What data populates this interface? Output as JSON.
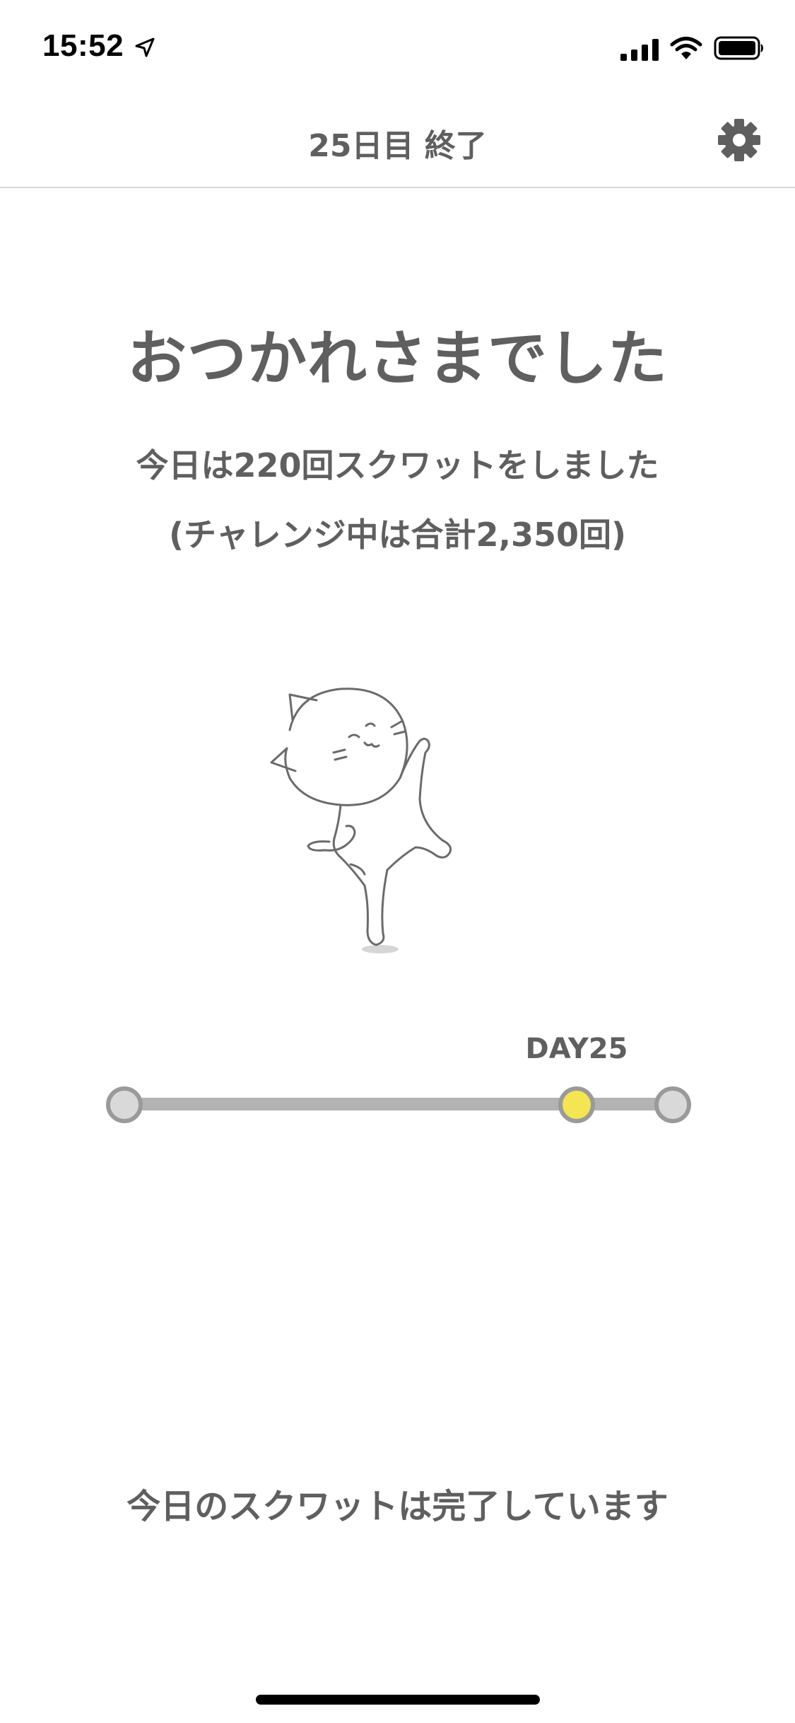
{
  "status_bar": {
    "time": "15:52",
    "icons": [
      "location-arrow-icon",
      "signal-icon",
      "wifi-icon",
      "battery-icon"
    ]
  },
  "nav": {
    "title": "25日目 終了",
    "settings_icon": "gear-icon"
  },
  "main": {
    "heading": "おつかれさまでした",
    "summary_line1": "今日は220回スクワットをしました",
    "summary_line2": "(チャレンジ中は合計2,350回)",
    "illustration": "dancing-cat"
  },
  "progress": {
    "current_label": "DAY25",
    "current_day": 25,
    "nodes": [
      {
        "state": "default"
      },
      {
        "state": "current"
      },
      {
        "state": "default"
      }
    ]
  },
  "footer": {
    "message": "今日のスクワットは完了しています"
  },
  "colors": {
    "text": "#5f5f5f",
    "track": "#b3b3b3",
    "node_border": "#9a9a9a",
    "node_fill": "#d9d9d9",
    "current_fill": "#f4e552"
  }
}
